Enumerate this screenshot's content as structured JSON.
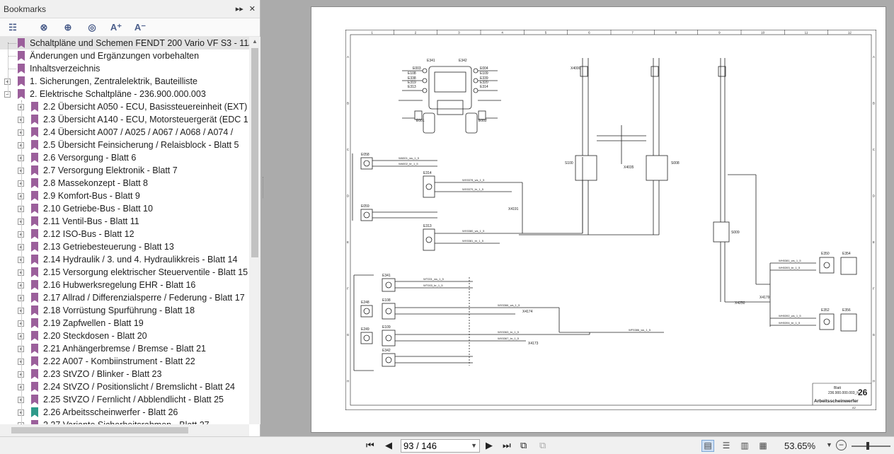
{
  "sidebar": {
    "title": "Bookmarks",
    "header_buttons": [
      "▸▸",
      "✕"
    ],
    "toolbar_icons": [
      "options-icon",
      "delete-bookmark-icon",
      "new-bookmark-icon",
      "bookmark-search-icon",
      "enlarge-text-icon",
      "reduce-text-icon"
    ],
    "items": [
      {
        "label": "Schaltpläne und Schemen FENDT 200 Vario VF S3 - 11/",
        "level": 0,
        "expand": "",
        "selected": true,
        "color": "purple"
      },
      {
        "label": "Änderungen und Ergänzungen vorbehalten",
        "level": 0,
        "expand": "",
        "color": "purple"
      },
      {
        "label": "Inhaltsverzeichnis",
        "level": 0,
        "expand": "",
        "color": "purple"
      },
      {
        "label": "1. Sicherungen, Zentralelektrik, Bauteilliste",
        "level": 0,
        "expand": "+",
        "color": "purple"
      },
      {
        "label": "2. Elektrische Schaltpläne - 236.900.000.003",
        "level": 0,
        "expand": "−",
        "color": "purple"
      },
      {
        "label": "2.2 Übersicht A050 - ECU, Basissteuereinheit (EXT) -",
        "level": 1,
        "expand": "+",
        "color": "purple"
      },
      {
        "label": "2.3 Übersicht A140 - ECU, Motorsteuergerät (EDC 1",
        "level": 1,
        "expand": "+",
        "color": "purple"
      },
      {
        "label": "2.4 Übersicht A007 / A025 / A067 / A068 / A074 /",
        "level": 1,
        "expand": "+",
        "color": "purple"
      },
      {
        "label": "2.5 Übersicht Feinsicherung / Relaisblock - Blatt 5",
        "level": 1,
        "expand": "+",
        "color": "purple"
      },
      {
        "label": "2.6 Versorgung - Blatt 6",
        "level": 1,
        "expand": "+",
        "color": "purple"
      },
      {
        "label": "2.7 Versorgung Elektronik - Blatt 7",
        "level": 1,
        "expand": "+",
        "color": "purple"
      },
      {
        "label": "2.8 Massekonzept - Blatt 8",
        "level": 1,
        "expand": "+",
        "color": "purple"
      },
      {
        "label": "2.9 Komfort-Bus - Blatt 9",
        "level": 1,
        "expand": "+",
        "color": "purple"
      },
      {
        "label": "2.10 Getriebe-Bus - Blatt 10",
        "level": 1,
        "expand": "+",
        "color": "purple"
      },
      {
        "label": "2.11 Ventil-Bus - Blatt 11",
        "level": 1,
        "expand": "+",
        "color": "purple"
      },
      {
        "label": "2.12 ISO-Bus - Blatt 12",
        "level": 1,
        "expand": "+",
        "color": "purple"
      },
      {
        "label": "2.13 Getriebesteuerung - Blatt 13",
        "level": 1,
        "expand": "+",
        "color": "purple"
      },
      {
        "label": "2.14 Hydraulik / 3. und 4. Hydraulikkreis - Blatt 14",
        "level": 1,
        "expand": "+",
        "color": "purple"
      },
      {
        "label": "2.15 Versorgung elektrischer Steuerventile - Blatt 15",
        "level": 1,
        "expand": "+",
        "color": "purple"
      },
      {
        "label": "2.16 Hubwerksregelung EHR - Blatt 16",
        "level": 1,
        "expand": "+",
        "color": "purple"
      },
      {
        "label": "2.17 Allrad / Differenzialsperre / Federung - Blatt 17",
        "level": 1,
        "expand": "+",
        "color": "purple"
      },
      {
        "label": "2.18 Vorrüstung Spurführung - Blatt 18",
        "level": 1,
        "expand": "+",
        "color": "purple"
      },
      {
        "label": "2.19 Zapfwellen - Blatt 19",
        "level": 1,
        "expand": "+",
        "color": "purple"
      },
      {
        "label": "2.20 Steckdosen - Blatt 20",
        "level": 1,
        "expand": "+",
        "color": "purple"
      },
      {
        "label": "2.21 Anhängerbremse / Bremse - Blatt 21",
        "level": 1,
        "expand": "+",
        "color": "purple"
      },
      {
        "label": "2.22 A007 - Kombiinstrument - Blatt 22",
        "level": 1,
        "expand": "+",
        "color": "purple"
      },
      {
        "label": "2.23 StVZO / Blinker - Blatt 23",
        "level": 1,
        "expand": "+",
        "color": "purple"
      },
      {
        "label": "2.24 StVZO / Positionslicht / Bremslicht - Blatt 24",
        "level": 1,
        "expand": "+",
        "color": "purple"
      },
      {
        "label": "2.25 StVZO / Fernlicht / Abblendlicht - Blatt 25",
        "level": 1,
        "expand": "+",
        "color": "purple"
      },
      {
        "label": "2.26 Arbeitsscheinwerfer - Blatt 26",
        "level": 1,
        "expand": "+",
        "color": "teal"
      },
      {
        "label": "2.27 Variante Sicherheitsrahmen - Blatt 27",
        "level": 1,
        "expand": "+",
        "color": "purple"
      }
    ]
  },
  "document": {
    "sheet_number": "26",
    "sheet_label": "Blatt",
    "drawing_number": "236.900.000.003_h",
    "sheet_title": "Arbeitsscheinwerfer",
    "format": "A2",
    "columns": [
      "1",
      "2",
      "3",
      "4",
      "5",
      "6",
      "7",
      "8",
      "9",
      "10",
      "11",
      "12"
    ],
    "rows": [
      "A",
      "B",
      "C",
      "D",
      "E",
      "F",
      "G",
      "H"
    ],
    "components": [
      "E058",
      "E314",
      "E059",
      "E313",
      "E341",
      "E248",
      "E108",
      "E249",
      "E109",
      "E342",
      "S100",
      "S008",
      "S009",
      "X4000",
      "X4035",
      "X4174",
      "X4173",
      "X4191",
      "X4250",
      "X4179",
      "E350",
      "E354",
      "E352",
      "E356",
      "E341",
      "E342",
      "E319",
      "E320",
      "E338",
      "E339",
      "E108",
      "E109",
      "E313",
      "E314",
      "E003",
      "E004",
      "E001",
      "E002"
    ],
    "wires": [
      "WA501_ws_1_5",
      "WA502_br_1_5",
      "WX5378_ws_1_5",
      "WX5379_br_1_5",
      "WX5380_ws_1_5",
      "WX5381_br_1_5",
      "WT001_ws_1_5",
      "WT003_br_1_5",
      "WX5366_ws_1_5",
      "WX5367_br_1_5",
      "WX5363_br_1_5",
      "WF5386_ws_1_5",
      "WH5381_ws_1_5",
      "WH5393_br_1_5",
      "WH5392_ws_1_5",
      "WH5394_br_1_5"
    ]
  },
  "bottombar": {
    "page_value": "93 / 146",
    "zoom": "53.65%"
  }
}
